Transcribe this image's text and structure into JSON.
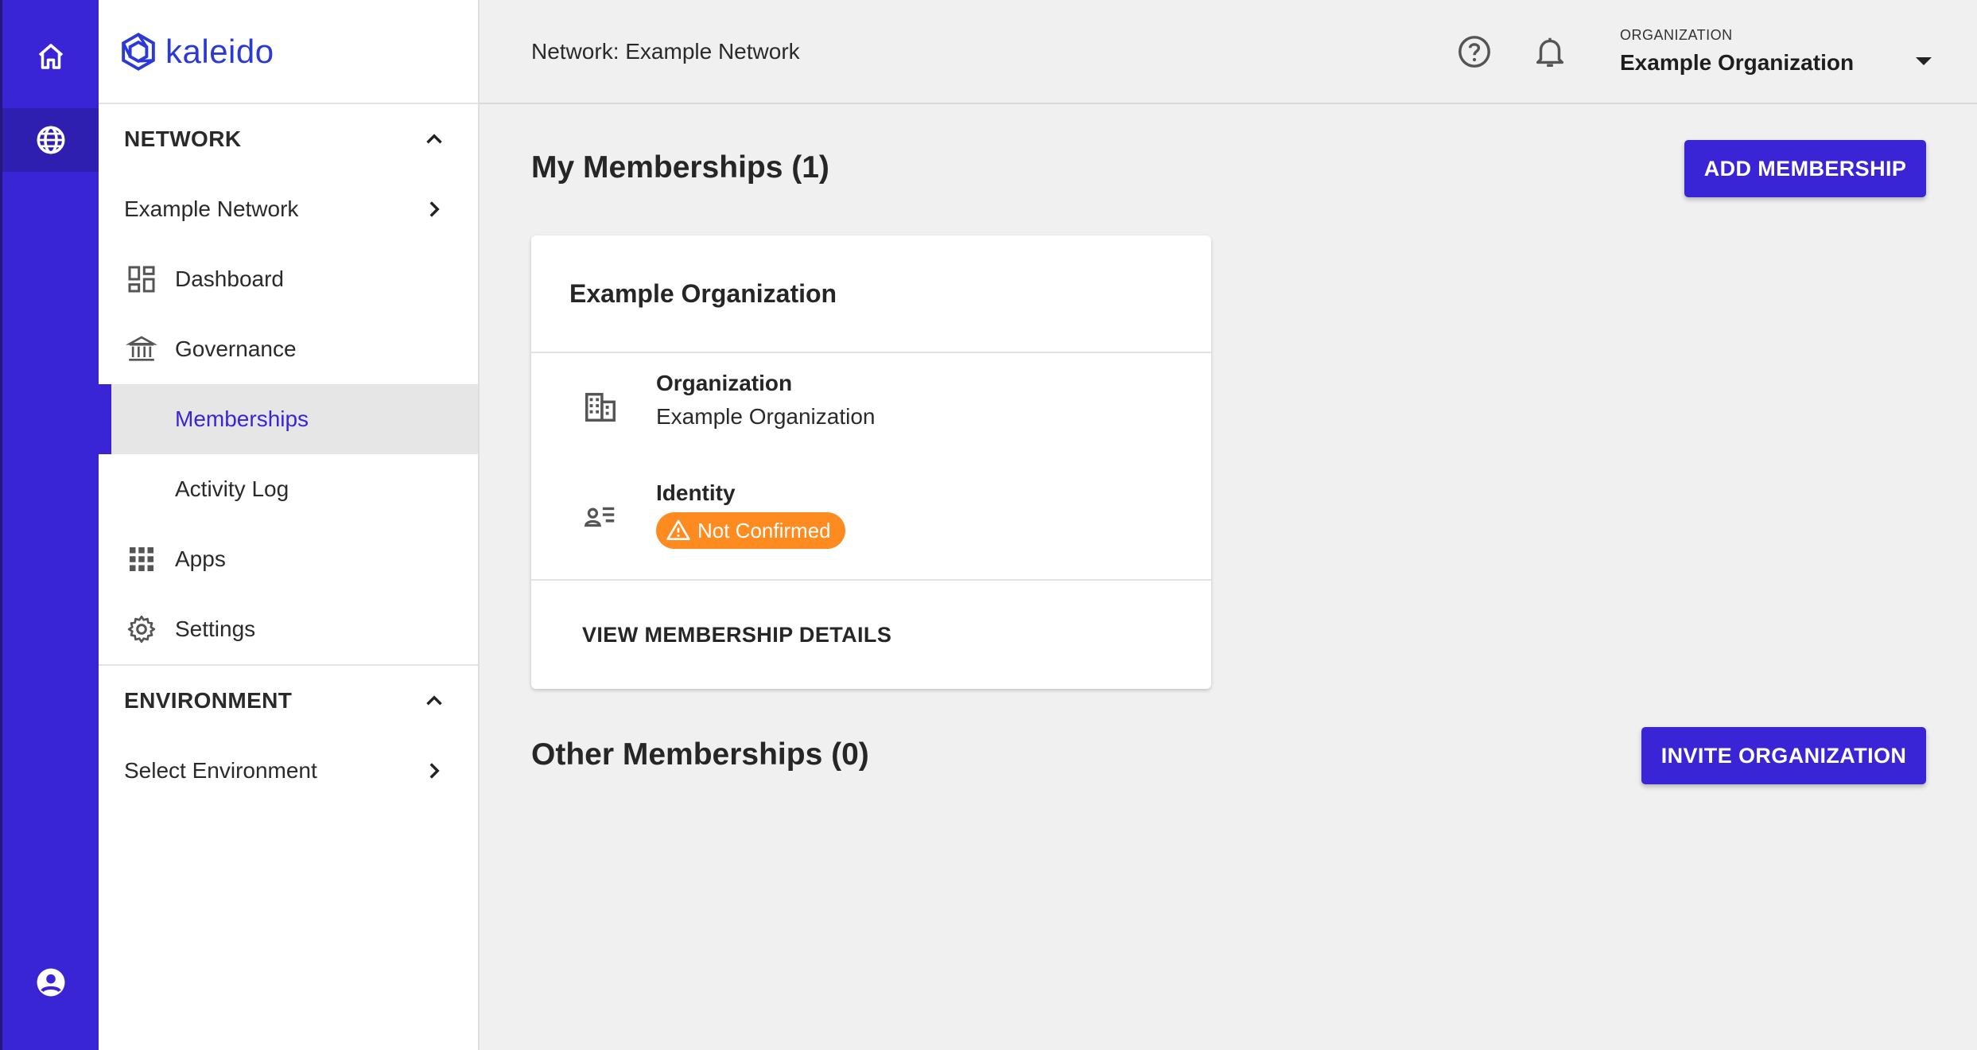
{
  "brand": {
    "name": "kaleido",
    "color": "#3a25d6"
  },
  "rail": {
    "items": [
      "home-icon",
      "globe-icon",
      "account-circle-icon"
    ]
  },
  "sidebar": {
    "network_section": "NETWORK",
    "network_drill": "Example Network",
    "items": [
      {
        "label": "Dashboard",
        "icon": "dashboard-icon"
      },
      {
        "label": "Governance",
        "icon": "bank-icon"
      },
      {
        "label": "Memberships",
        "active": true
      },
      {
        "label": "Activity Log"
      },
      {
        "label": "Apps",
        "icon": "apps-grid-icon"
      },
      {
        "label": "Settings",
        "icon": "gear-icon"
      }
    ],
    "environment_section": "ENVIRONMENT",
    "environment_drill": "Select Environment"
  },
  "header": {
    "breadcrumb": "Network: Example Network",
    "org_caption": "ORGANIZATION",
    "org_value": "Example Organization"
  },
  "main": {
    "my_title": "My Memberships (1)",
    "add_button": "ADD MEMBERSHIP",
    "card": {
      "title": "Example Organization",
      "org_label": "Organization",
      "org_value": "Example Organization",
      "identity_label": "Identity",
      "identity_status": "Not Confirmed",
      "status_color": "#fd8b1f",
      "details_link": "VIEW MEMBERSHIP DETAILS"
    },
    "other_title": "Other Memberships (0)",
    "invite_button": "INVITE ORGANIZATION"
  }
}
